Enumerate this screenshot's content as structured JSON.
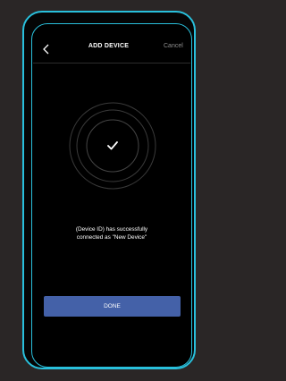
{
  "header": {
    "title": "ADD DEVICE",
    "cancel_label": "Cancel",
    "back_icon": "chevron-left-icon"
  },
  "status": {
    "icon": "checkmark-icon",
    "message_line1": "(Device ID) has successfully",
    "message_line2": "connected as \"New Device\""
  },
  "actions": {
    "done_label": "DONE"
  },
  "colors": {
    "background": "#2a2626",
    "frame_accent": "#29c0dc",
    "screen": "#000000",
    "primary_button": "#4461a8",
    "muted_text": "#8e8e8e"
  }
}
